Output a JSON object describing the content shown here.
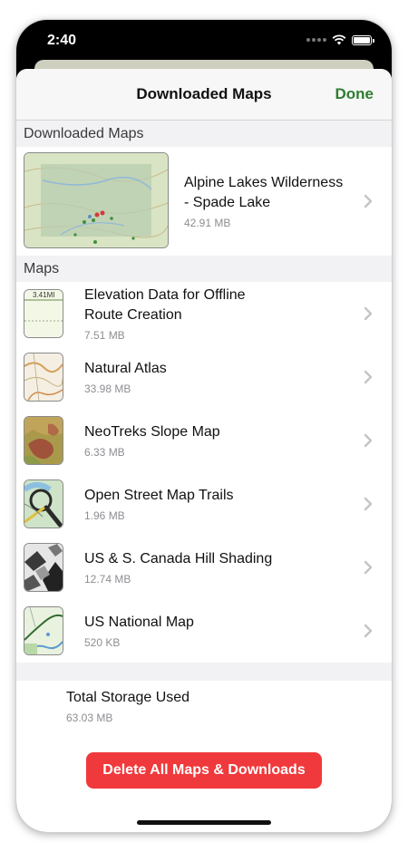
{
  "status_bar": {
    "time": "2:40"
  },
  "nav": {
    "title": "Downloaded Maps",
    "done_label": "Done"
  },
  "sections": {
    "downloaded_header": "Downloaded Maps",
    "maps_header": "Maps"
  },
  "featured": {
    "title_line1": "Alpine Lakes Wilderness",
    "title_line2": "- Spade Lake",
    "size": "42.91 MB"
  },
  "maps": [
    {
      "title_line1": "Elevation Data for Offline",
      "title_line2": "Route Creation",
      "size": "7.51 MB",
      "thumb_label": "3.41MI",
      "icon": "elevation-profile-icon"
    },
    {
      "title_line1": "Natural Atlas",
      "size": "33.98 MB",
      "icon": "natural-atlas-thumbnail"
    },
    {
      "title_line1": "NeoTreks Slope Map",
      "size": "6.33 MB",
      "icon": "slope-map-thumbnail"
    },
    {
      "title_line1": "Open Street Map Trails",
      "size": "1.96 MB",
      "icon": "osm-trails-thumbnail"
    },
    {
      "title_line1": "US & S. Canada Hill Shading",
      "size": "12.74 MB",
      "icon": "hill-shading-thumbnail"
    },
    {
      "title_line1": "US National Map",
      "size": "520 KB",
      "icon": "national-map-thumbnail"
    }
  ],
  "storage": {
    "title": "Total Storage Used",
    "value": "63.03 MB"
  },
  "delete_button": {
    "label": "Delete All Maps & Downloads"
  },
  "colors": {
    "accent": "#2e7d32",
    "destructive": "#f0393c",
    "secondary_text": "#8e8e93"
  }
}
